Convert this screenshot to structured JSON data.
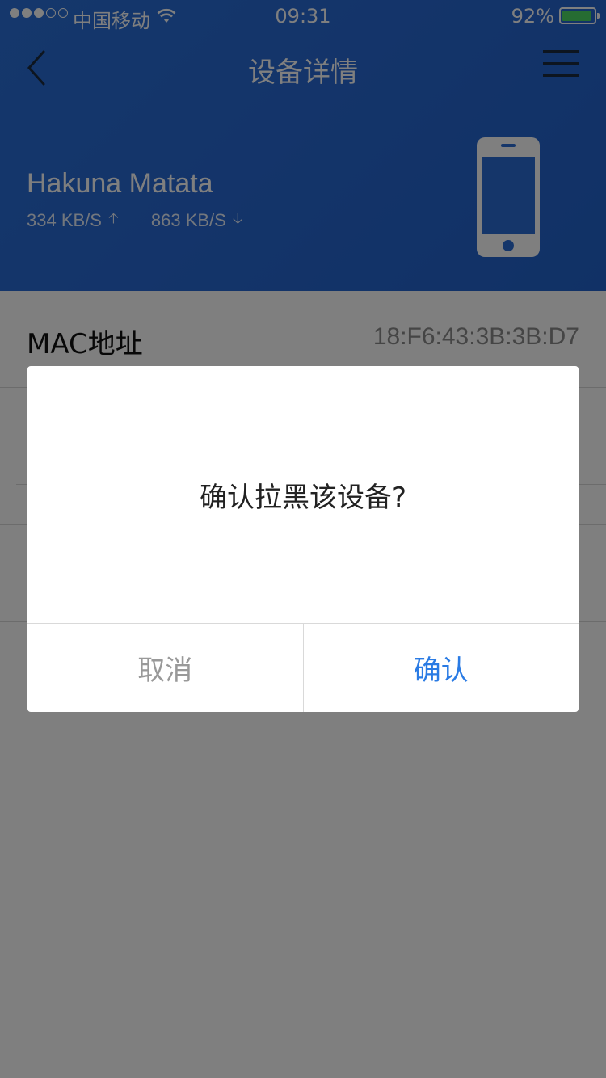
{
  "status_bar": {
    "carrier": "中国移动",
    "time": "09:31",
    "battery_percent": "92%",
    "battery_level": 0.92,
    "signal_bars": 3,
    "signal_total": 5,
    "icons": {
      "wifi": "wifi-icon",
      "battery": "battery-icon"
    }
  },
  "nav": {
    "title": "设备详情",
    "back_icon": "chevron-left-icon",
    "menu_icon": "hamburger-menu-icon"
  },
  "device": {
    "name": "Hakuna Matata",
    "upload_speed": "334 KB/S",
    "download_speed": "863 KB/S",
    "upload_arrow": "🡡",
    "download_arrow": "🡣",
    "icon": "smartphone-icon"
  },
  "list": {
    "mac_label": "MAC地址",
    "mac_value": "18:F6:43:3B:3B:D7"
  },
  "dialog": {
    "message": "确认拉黑该设备?",
    "cancel_label": "取消",
    "confirm_label": "确认"
  },
  "colors": {
    "header_blue": "#2869d4",
    "confirm_blue": "#2a7be4",
    "battery_green": "#4cd964"
  }
}
